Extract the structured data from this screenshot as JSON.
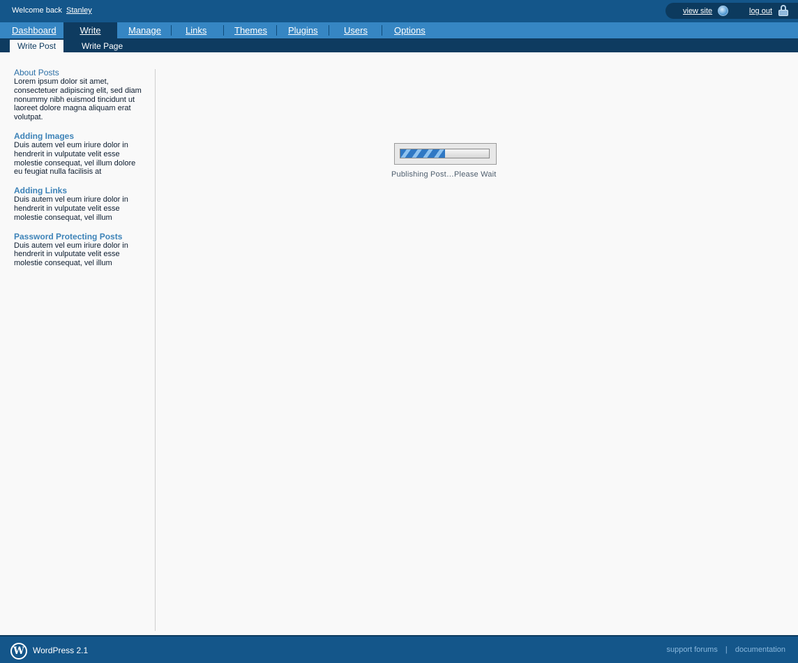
{
  "header": {
    "welcome_text": "Welcome back",
    "username": "Stanley",
    "view_site_label": "view site",
    "log_out_label": "log out"
  },
  "nav": {
    "items": [
      {
        "label": "Dashboard"
      },
      {
        "label": "Write"
      },
      {
        "label": "Manage"
      },
      {
        "label": "Links"
      },
      {
        "label": "Themes"
      },
      {
        "label": "Plugins"
      },
      {
        "label": "Users"
      },
      {
        "label": "Options"
      }
    ],
    "active": "Write"
  },
  "subnav": {
    "items": [
      {
        "label": "Write Post"
      },
      {
        "label": "Write Page"
      }
    ],
    "active": "Write Post"
  },
  "sidebar": {
    "sections": [
      {
        "title": "About Posts",
        "body": "Lorem ipsum dolor sit amet, consectetuer adipiscing elit, sed diam nonummy nibh euismod tincidunt ut laoreet dolore magna aliquam erat volutpat."
      },
      {
        "title": "Adding Images",
        "body": "Duis autem vel eum iriure dolor in hendrerit in vulputate velit esse molestie consequat, vel illum dolore eu feugiat nulla facilisis at"
      },
      {
        "title": "Adding Links",
        "body": "Duis autem vel eum iriure dolor in hendrerit in vulputate velit esse molestie consequat, vel illum"
      },
      {
        "title": "Password Protecting Posts",
        "body": "Duis autem vel eum iriure dolor in hendrerit in vulputate velit esse molestie consequat, vel illum"
      }
    ]
  },
  "progress": {
    "status_text": "Publishing Post…Please Wait",
    "fraction": 0.5
  },
  "footer": {
    "version_label": "WordPress 2.1",
    "support_label": "support forums",
    "separator": "|",
    "docs_label": "documentation"
  },
  "colors": {
    "header_bg": "#14568a",
    "nav_bg": "#3686c3",
    "active_bg": "#0e3b60",
    "link_title": "#2b6fa6"
  }
}
